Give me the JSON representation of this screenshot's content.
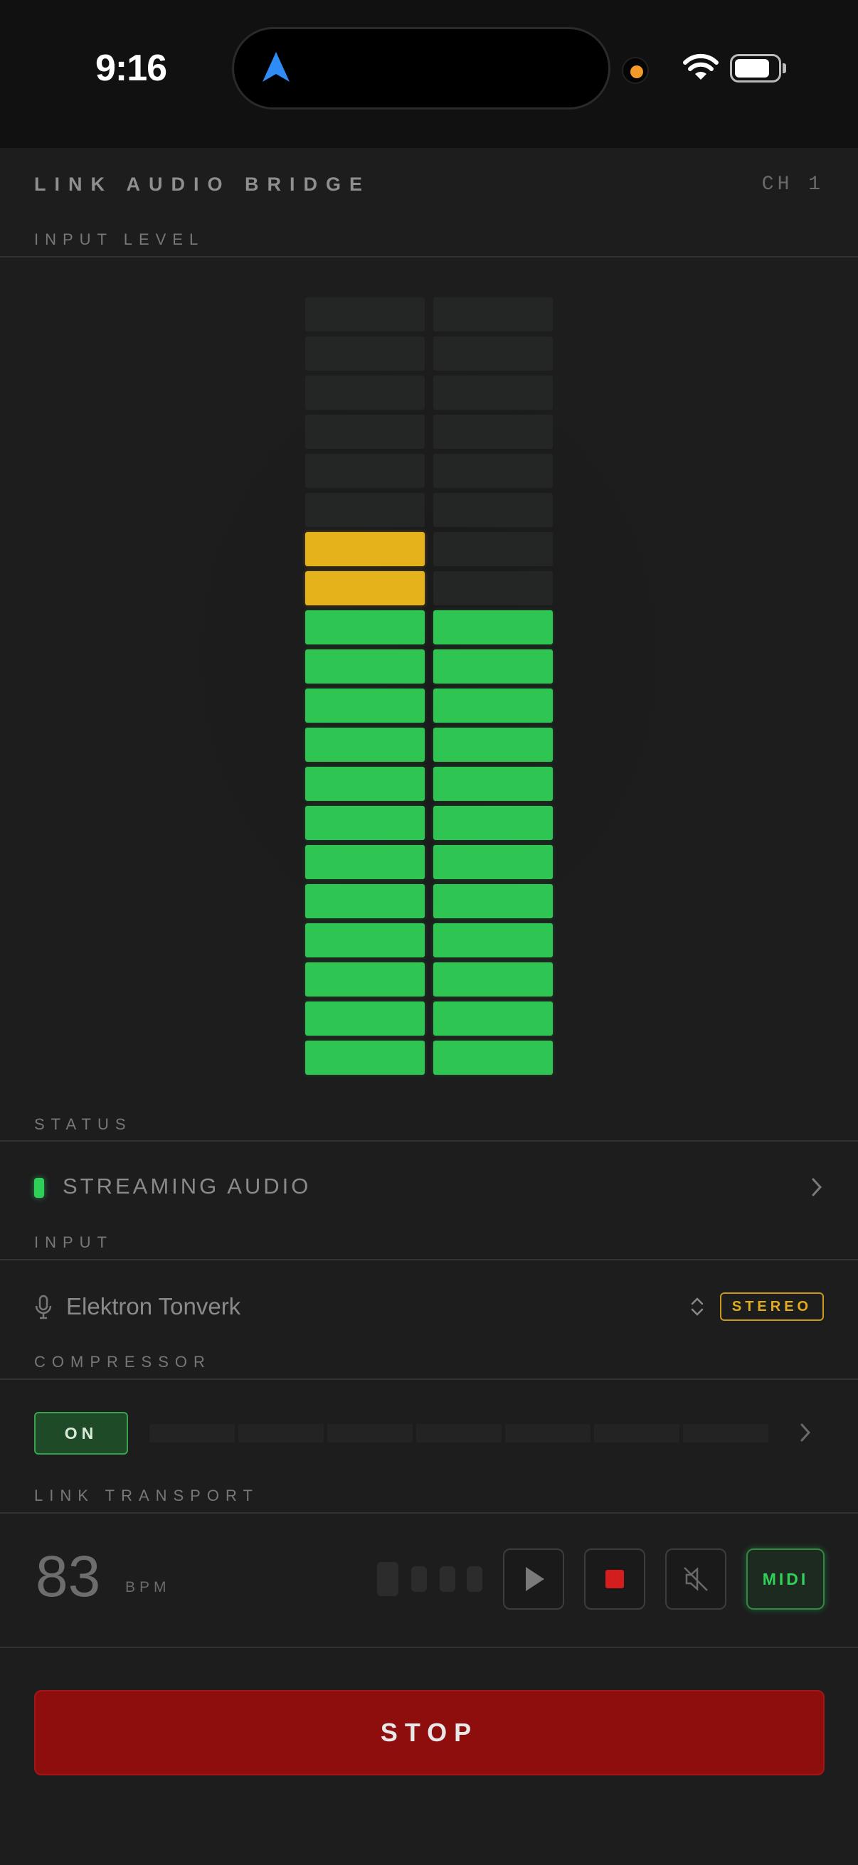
{
  "status_bar": {
    "time": "9:16"
  },
  "header": {
    "title": "LINK AUDIO BRIDGE",
    "channel": "CH 1"
  },
  "sections": {
    "input_level": "INPUT LEVEL",
    "status": "STATUS",
    "input": "INPUT",
    "compressor": "COMPRESSOR",
    "link_transport": "LINK TRANSPORT"
  },
  "meter": {
    "segments_per_channel": 20,
    "left_lit_segments": 14,
    "right_lit_segments": 12,
    "colors": {
      "green": "#2fc552",
      "yellow": "#e6b21b",
      "off": "#242525"
    }
  },
  "status": {
    "text": "STREAMING AUDIO",
    "indicator_color": "#2fd05a"
  },
  "input": {
    "device": "Elektron Tonverk",
    "mode_badge": "STEREO"
  },
  "compressor": {
    "toggle_label": "ON",
    "gain_reduction_level": 0
  },
  "transport": {
    "bpm_value": "83",
    "bpm_unit": "BPM",
    "midi_label": "MIDI"
  },
  "stop_button": {
    "label": "STOP",
    "color": "#8e0e0e"
  },
  "icons": [
    "navigation-arrow-icon",
    "wifi-icon",
    "battery-icon",
    "chevron-right-icon",
    "microphone-icon",
    "updown-chevron-icon",
    "play-icon",
    "stop-square-icon",
    "mute-icon"
  ]
}
